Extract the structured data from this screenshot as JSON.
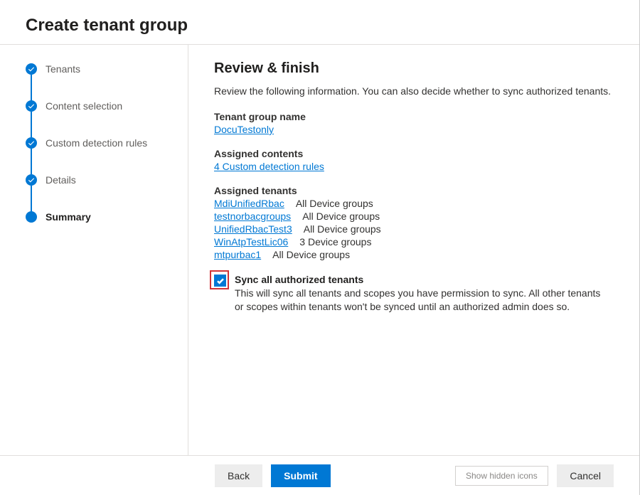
{
  "page_title": "Create tenant group",
  "steps": [
    {
      "label": "Tenants"
    },
    {
      "label": "Content selection"
    },
    {
      "label": "Custom detection rules"
    },
    {
      "label": "Details"
    },
    {
      "label": "Summary"
    }
  ],
  "main": {
    "heading": "Review & finish",
    "subtitle": "Review the following information. You can also decide whether to sync authorized tenants.",
    "group_name_label": "Tenant group name",
    "group_name_value": "DocuTestonly",
    "assigned_contents_label": "Assigned contents",
    "assigned_contents_value": "4 Custom detection rules",
    "assigned_tenants_label": "Assigned tenants",
    "tenants": [
      {
        "name": "MdiUnifiedRbac",
        "scope": "All Device groups"
      },
      {
        "name": "testnorbacgroups",
        "scope": "All Device groups"
      },
      {
        "name": "UnifiedRbacTest3",
        "scope": "All Device groups"
      },
      {
        "name": "WinAtpTestLic06",
        "scope": "3 Device groups"
      },
      {
        "name": "mtpurbac1",
        "scope": "All Device groups"
      }
    ],
    "sync_checkbox_label": "Sync all authorized tenants",
    "sync_checkbox_help": "This will sync all tenants and scopes you have permission to sync. All other tenants or scopes within tenants won't be synced until an authorized admin does so."
  },
  "footer": {
    "back": "Back",
    "submit": "Submit",
    "show_hidden_icons": "Show hidden icons",
    "cancel": "Cancel"
  }
}
